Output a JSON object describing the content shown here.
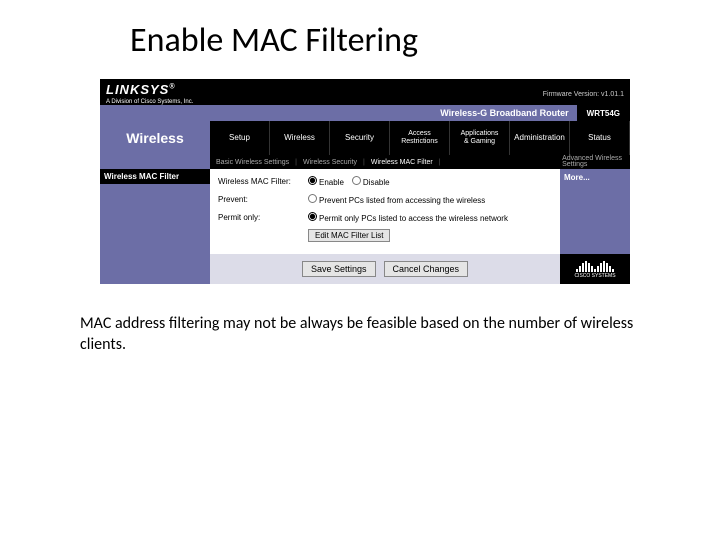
{
  "slide_title": "Enable MAC Filtering",
  "top": {
    "logo": "LINKSYS",
    "logo_reg": "®",
    "logo_sub": "A Division of Cisco Systems, Inc.",
    "firmware": "Firmware Version: v1.01.1"
  },
  "model_row": {
    "router_name": "Wireless-G Broadband Router",
    "model": "WRT54G"
  },
  "section_label": "Wireless",
  "tabs": [
    "Setup",
    "Wireless",
    "Security",
    "Access\nRestrictions",
    "Applications\n& Gaming",
    "Administration",
    "Status"
  ],
  "subtabs": {
    "items": [
      "Basic Wireless Settings",
      "Wireless Security",
      "Wireless MAC Filter",
      "Advanced Wireless\nSettings"
    ]
  },
  "side_box_label": "Wireless MAC Filter",
  "form": {
    "row1_label": "Wireless MAC Filter:",
    "row1_opts": [
      "Enable",
      "Disable"
    ],
    "row2_label": "Prevent:",
    "row2_text": "Prevent PCs listed from accessing the wireless",
    "row3_label": "Permit only:",
    "row3_text": "Permit only PCs listed to access the wireless network",
    "edit_btn": "Edit MAC Filter List"
  },
  "more_label": "More...",
  "footer_btns": {
    "save": "Save Settings",
    "cancel": "Cancel Changes"
  },
  "cisco_label": "CISCO SYSTEMS",
  "caption": "MAC address filtering may not be always be feasible based on the number of wireless clients."
}
